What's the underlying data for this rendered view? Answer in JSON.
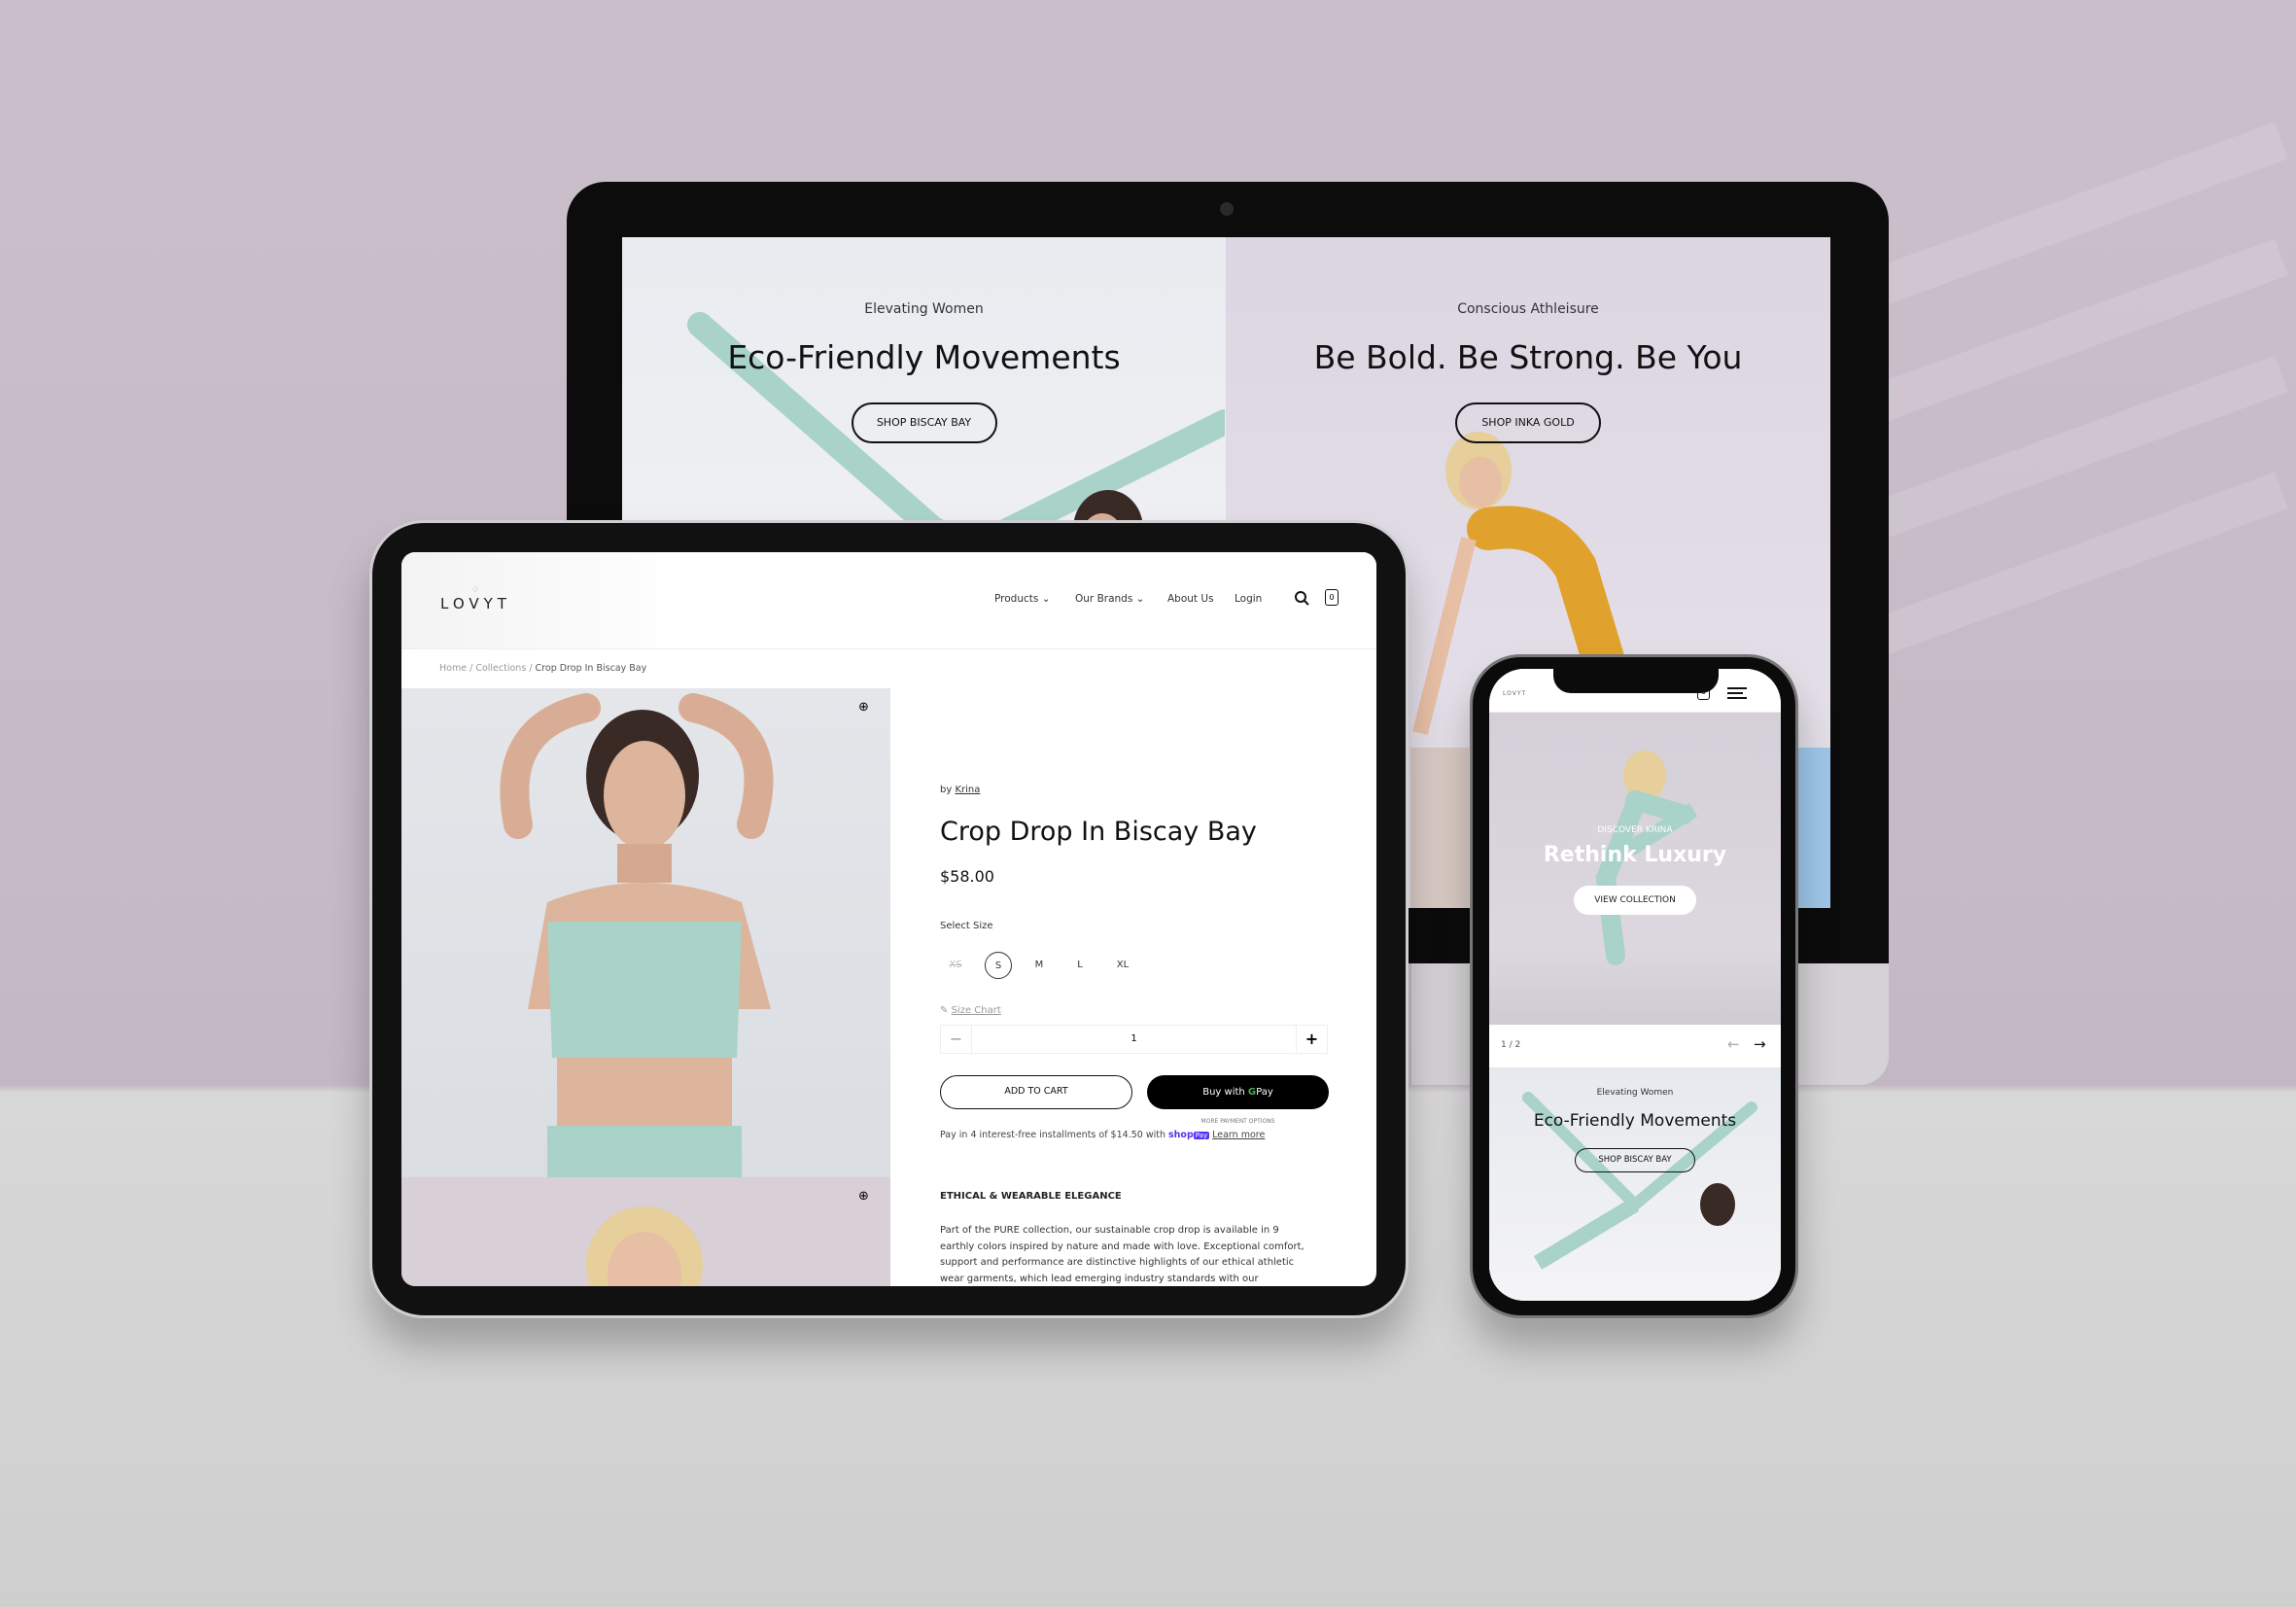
{
  "monitor": {
    "left_panel": {
      "eyebrow": "Elevating Women",
      "title": "Eco-Friendly Movements",
      "button": "SHOP BISCAY BAY"
    },
    "right_panel": {
      "eyebrow": "Conscious Athleisure",
      "title": "Be Bold. Be Strong. Be You",
      "button": "SHOP INKA GOLD"
    }
  },
  "tablet": {
    "logo": "LOVYT",
    "nav": {
      "products": "Products",
      "brands": "Our Brands",
      "about": "About Us",
      "login": "Login",
      "cart_count": "0"
    },
    "breadcrumb": {
      "home": "Home",
      "sep": "/",
      "collections": "Collections",
      "current": "Crop Drop In Biscay Bay"
    },
    "product": {
      "by": "by",
      "brand": "Krina",
      "title": "Crop Drop In Biscay Bay",
      "price": "$58.00",
      "size_label": "Select Size",
      "sizes": [
        "XS",
        "S",
        "M",
        "L",
        "XL"
      ],
      "selected_size": "S",
      "unavailable_size": "XS",
      "size_chart": "Size Chart",
      "quantity": "1",
      "minus": "−",
      "plus": "+",
      "add_to_cart": "ADD TO CART",
      "buy_with": "Buy with",
      "gpay_g": "G",
      "gpay_pay": "Pay",
      "more_payment": "MORE PAYMENT OPTIONS",
      "installments": "Pay in 4 interest-free installments of $14.50 with",
      "shop": "shop",
      "shop_pay_badge": "Pay",
      "learn_more": "Learn more",
      "desc_heading": "ETHICAL & WEARABLE ELEGANCE",
      "desc_lines": [
        "Part of the PURE collection, our sustainable crop drop is available in 9",
        "earthly colors inspired by nature and made with love. Exceptional comfort,",
        "support and performance are distinctive highlights of our ethical athletic",
        "wear garments, which lead emerging industry standards with our"
      ]
    }
  },
  "phone": {
    "logo": "LOVYT",
    "cart_count": "0",
    "hero": {
      "eyebrow": "DISCOVER KRINA",
      "title": "Rethink Luxury",
      "button": "VIEW COLLECTION"
    },
    "pager": "1 / 2",
    "section": {
      "eyebrow": "Elevating Women",
      "title": "Eco-Friendly Movements",
      "button": "SHOP BISCAY BAY"
    }
  },
  "colors": {
    "mint": "#a9d2c8",
    "gold": "#e0a22c",
    "shop_pay": "#5a31f4",
    "lavender_bg": "#c9bcc9"
  }
}
